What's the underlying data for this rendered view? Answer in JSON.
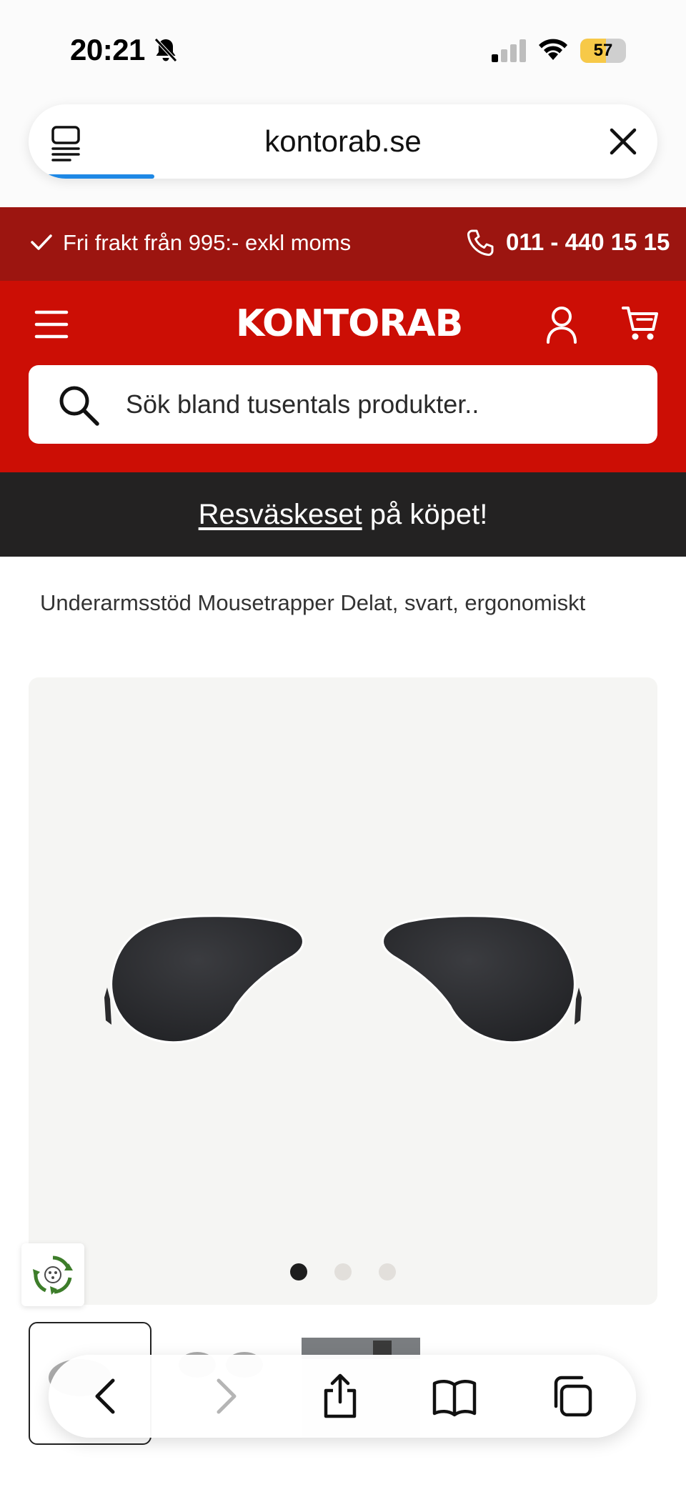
{
  "status_bar": {
    "time": "20:21",
    "battery_level": 57,
    "battery_label": "57",
    "icons": [
      "bell-slash-icon",
      "cellular-signal-icon",
      "wifi-icon",
      "battery-icon"
    ]
  },
  "browser": {
    "url": "kontorab.se",
    "load_progress": 0.2,
    "icons": [
      "reader-icon",
      "close-icon"
    ],
    "accent_color": "#1e88e5"
  },
  "promo_bar": {
    "text": "Fri frakt från 995:- exkl moms",
    "phone": "011 - 440 15 15",
    "background": "#9c1510"
  },
  "header": {
    "logo": "KONTORAB",
    "background": "#cc0e05",
    "icons": [
      "menu-icon",
      "user-icon",
      "cart-icon"
    ]
  },
  "search": {
    "placeholder": "Sök bland tusentals produkter..",
    "value": ""
  },
  "campaign": {
    "link_text": "Resväskeset",
    "text": " på köpet!"
  },
  "product": {
    "title": "Underarmsstöd Mousetrapper Delat, svart, ergonomiskt",
    "image_count": 3,
    "active_image": 1
  },
  "toolbar": {
    "icons": [
      "back-icon",
      "forward-icon",
      "share-icon",
      "bookmarks-icon",
      "tabs-icon"
    ]
  }
}
